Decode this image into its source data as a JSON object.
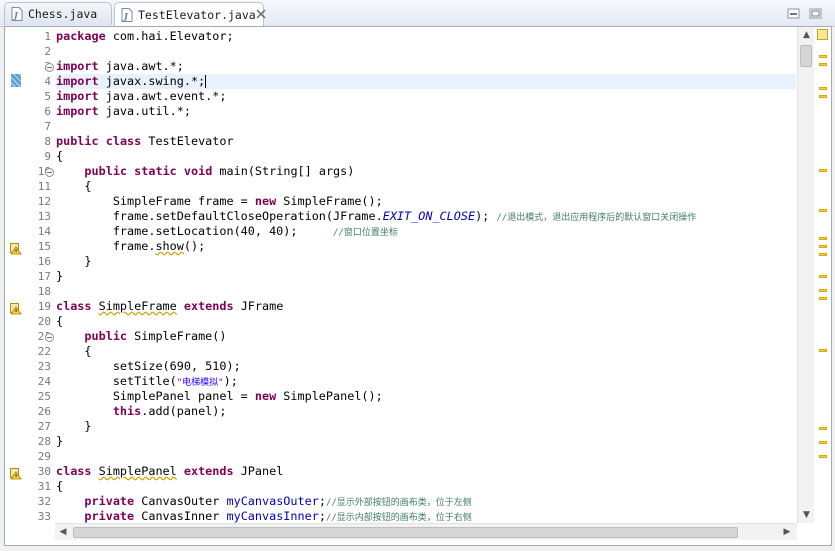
{
  "tabs": [
    {
      "label": "Chess.java",
      "active": false
    },
    {
      "label": "TestElevator.java",
      "active": true
    }
  ],
  "window_controls": {
    "minimize": "minimize-icon",
    "maximize": "maximize-icon"
  },
  "line_numbers": [
    "1",
    "2",
    "3",
    "4",
    "5",
    "6",
    "7",
    "8",
    "9",
    "10",
    "11",
    "12",
    "13",
    "14",
    "15",
    "16",
    "17",
    "18",
    "19",
    "20",
    "21",
    "22",
    "23",
    "24",
    "25",
    "26",
    "27",
    "28",
    "29",
    "30",
    "31",
    "32",
    "33"
  ],
  "code": {
    "l1": {
      "kw": "package",
      "rest": " com.hai.Elevator;"
    },
    "l3": {
      "kw": "import",
      "rest": " java.awt.*;"
    },
    "l4": {
      "kw": "import",
      "rest": " javax.swing.*;"
    },
    "l5": {
      "kw": "import",
      "rest": " java.awt.event.*;"
    },
    "l6": {
      "kw": "import",
      "rest": " java.util.*;"
    },
    "l8": {
      "kw1": "public",
      "kw2": "class",
      "rest": " TestElevator"
    },
    "l9": "{",
    "l10": {
      "kw1": "public",
      "kw2": "static",
      "kw3": "void",
      "rest": " main(String[] args)"
    },
    "l11": "{",
    "l12": {
      "pre": "SimpleFrame frame = ",
      "kw": "new",
      "rest": " SimpleFrame();"
    },
    "l13": {
      "pre": "frame.setDefaultCloseOperation(JFrame.",
      "const": "EXIT_ON_CLOSE",
      "rest": "); ",
      "comment": "//退出模式，退出应用程序后的默认窗口关闭操作"
    },
    "l14": {
      "pre": "frame.setLocation(40, 40);     ",
      "comment": "//窗口位置坐标"
    },
    "l15": {
      "pre": "frame.",
      "warn": "show",
      "rest": "();"
    },
    "l16": "}",
    "l17": "}",
    "l19": {
      "kw1": "class",
      "name": "SimpleFrame",
      "kw2": "extends",
      "rest": " JFrame"
    },
    "l20": "{",
    "l21": {
      "kw": "public",
      "rest": " SimpleFrame()"
    },
    "l22": "{",
    "l23": "setSize(690, 510);",
    "l24": {
      "pre": "setTitle(",
      "str": "\"电梯模拟\"",
      "rest": ");"
    },
    "l25": {
      "pre": "SimplePanel panel = ",
      "kw": "new",
      "rest": " SimplePanel();"
    },
    "l26": {
      "kw": "this",
      "rest": ".add(panel);"
    },
    "l27": "}",
    "l28": "}",
    "l30": {
      "kw1": "class",
      "name": "SimplePanel",
      "kw2": "extends",
      "rest": " JPanel"
    },
    "l31": "{",
    "l32": {
      "kw": "private",
      "type": " CanvasOuter ",
      "field": "myCanvasOuter",
      "rest": ";",
      "comment": "//显示外部按钮的画布类，位于左侧"
    },
    "l33": {
      "kw": "private",
      "type": " CanvasInner ",
      "field": "myCanvasInner",
      "rest": ";",
      "comment": "//显示内部按钮的画布类，位于右侧"
    }
  },
  "colors": {
    "keyword": "#7f0055",
    "comment": "#3f7f5f",
    "string": "#2a00ff",
    "constant": "#0000c0",
    "line_number": "#787878",
    "current_line": "#e8f2fe"
  },
  "icons": {
    "java_file": "java-file-icon",
    "close": "close-icon",
    "warning": "warning-icon",
    "fold": "fold-minus-icon"
  }
}
